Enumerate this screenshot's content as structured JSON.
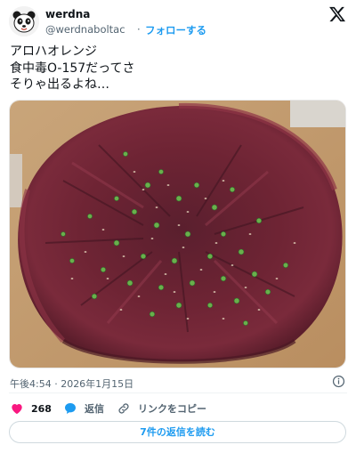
{
  "author": {
    "name": "werdna",
    "handle": "@werdnaboltac",
    "separator": "·",
    "follow_label": "フォローする"
  },
  "tweet": {
    "lines": [
      "アロハオレンジ",
      "食中毒O-157だってさ",
      "そりゃ出るよね…"
    ]
  },
  "media": {
    "description_icon": "photo-of-raw-meat-platter"
  },
  "meta": {
    "timestamp": "午後4:54 · 2026年1月15日"
  },
  "actions": {
    "like_count": "268",
    "reply_label": "返信",
    "copy_link_label": "リンクをコピー"
  },
  "read_replies_label": "7件の返信を読む",
  "colors": {
    "accent": "#1d9bf0",
    "like": "#f91880",
    "reply_icon": "#1d9bf0",
    "text": "#0f1419",
    "muted": "#536471"
  }
}
